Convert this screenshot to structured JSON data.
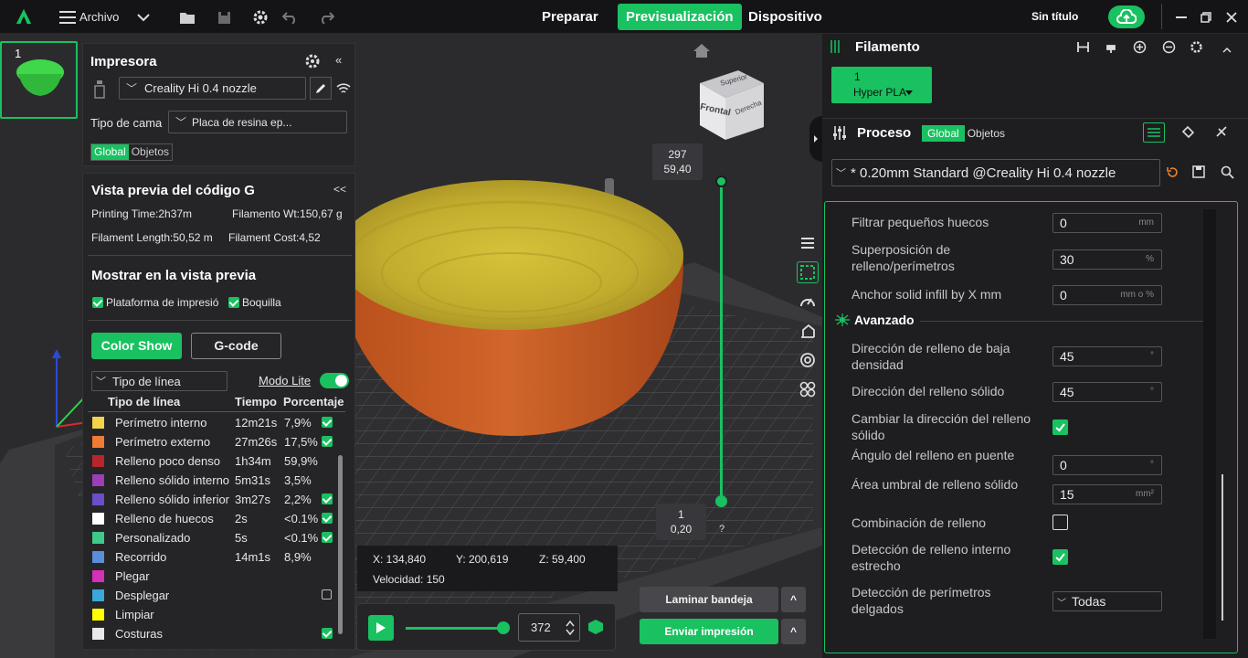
{
  "app": {
    "menu_label": "Archivo",
    "doc_title": "Sin título"
  },
  "tabs": [
    {
      "label": "Preparar"
    },
    {
      "label": "Previsualización"
    },
    {
      "label": "Dispositivo"
    }
  ],
  "plate": {
    "number": "1"
  },
  "printer": {
    "title": "Impresora",
    "name": "Creality Hi 0.4 nozzle",
    "bed_label": "Tipo de cama",
    "bed_value": "Placa de resina ep...",
    "global": "Global",
    "objects": "Objetos",
    "collapse": "«"
  },
  "gcode": {
    "title": "Vista previa del código G",
    "collapse": "<<",
    "printing_time": "Printing Time:2h37m",
    "filament_wt": "Filamento Wt:150,67 g",
    "filament_length": "Filament Length:50,52 m",
    "filament_cost": "Filament Cost:4,52",
    "show_title": "Mostrar en la vista previa",
    "plate_chk": "Plataforma de impresió",
    "nozzle_chk": "Boquilla",
    "color_show": "Color Show",
    "gcode_btn": "G-code",
    "line_type_select": "Tipo de línea",
    "lite_mode": "Modo Lite",
    "headers": [
      "Tipo de línea",
      "Tiempo",
      "Porcentaje"
    ],
    "rows": [
      {
        "name": "Perímetro interno",
        "time": "12m21s",
        "pct": "7,9%",
        "color": "#f5d34a",
        "checked": true
      },
      {
        "name": "Perímetro externo",
        "time": "27m26s",
        "pct": "17,5%",
        "color": "#f07b35",
        "checked": true
      },
      {
        "name": "Relleno poco denso",
        "time": "1h34m",
        "pct": "59,9%",
        "color": "#b8252a",
        "checked": false
      },
      {
        "name": "Relleno sólido interno",
        "time": "5m31s",
        "pct": "3,5%",
        "color": "#9a3fb5",
        "checked": false
      },
      {
        "name": "Relleno sólido inferior",
        "time": "3m27s",
        "pct": "2,2%",
        "color": "#6a4fc8",
        "checked": true
      },
      {
        "name": "Relleno de huecos",
        "time": "2s",
        "pct": "<0.1%",
        "color": "#ffffff",
        "checked": true
      },
      {
        "name": "Personalizado",
        "time": "5s",
        "pct": "<0.1%",
        "color": "#3fc88a",
        "checked": true
      },
      {
        "name": "Recorrido",
        "time": "14m1s",
        "pct": "8,9%",
        "color": "#5a8ed8",
        "checked": false
      },
      {
        "name": "Plegar",
        "time": "",
        "pct": "",
        "color": "#d62fb8",
        "checked": false
      },
      {
        "name": "Desplegar",
        "time": "",
        "pct": "",
        "color": "#3aa8d8",
        "checked": false,
        "empty_box": true
      },
      {
        "name": "Limpiar",
        "time": "",
        "pct": "",
        "color": "#ffff00",
        "checked": false
      },
      {
        "name": "Costuras",
        "time": "",
        "pct": "",
        "color": "#e8e8e8",
        "checked": true
      }
    ]
  },
  "viewcube": {
    "top": "Superior",
    "front": "Frontal",
    "right": "Derecha"
  },
  "layer_slider": {
    "top_layer": "297",
    "top_height": "59,40",
    "bottom_layer": "1",
    "bottom_height": "0,20",
    "help": "?"
  },
  "position": {
    "x": "X: 134,840",
    "y": "Y: 200,619",
    "z": "Z: 59,400",
    "speed": "Velocidad: 150"
  },
  "playback": {
    "value": "372"
  },
  "actions": {
    "slice": "Laminar bandeja",
    "print": "Enviar impresión",
    "caret": "^"
  },
  "filament": {
    "title": "Filamento",
    "slot": "1",
    "material": "Hyper PLA"
  },
  "process": {
    "title": "Proceso",
    "global": "Global",
    "objects": "Objetos",
    "preset": "* 0.20mm Standard @Creality Hi 0.4 nozzle",
    "advanced": "Avanzado",
    "settings": [
      {
        "label": "Filtrar pequeños huecos",
        "value": "0",
        "unit": "mm"
      },
      {
        "label": "Superposición de relleno/perímetros",
        "value": "30",
        "unit": "%"
      },
      {
        "label": "Anchor solid infill by X mm",
        "value": "0",
        "unit": "mm o %"
      },
      {
        "label": "Dirección de relleno de baja densidad",
        "value": "45",
        "unit": "°"
      },
      {
        "label": "Dirección del relleno sólido",
        "value": "45",
        "unit": "°"
      },
      {
        "label": "Cambiar la dirección del relleno sólido",
        "checked": true
      },
      {
        "label": "Ángulo del relleno en puente",
        "value": "0",
        "unit": "°"
      },
      {
        "label": "Área umbral de relleno sólido",
        "value": "15",
        "unit": "mm²"
      },
      {
        "label": "Combinación de relleno",
        "checked": false
      },
      {
        "label": "Detección de relleno interno estrecho",
        "checked": true
      },
      {
        "label": "Detección de perímetros delgados",
        "value": "Todas"
      }
    ]
  }
}
